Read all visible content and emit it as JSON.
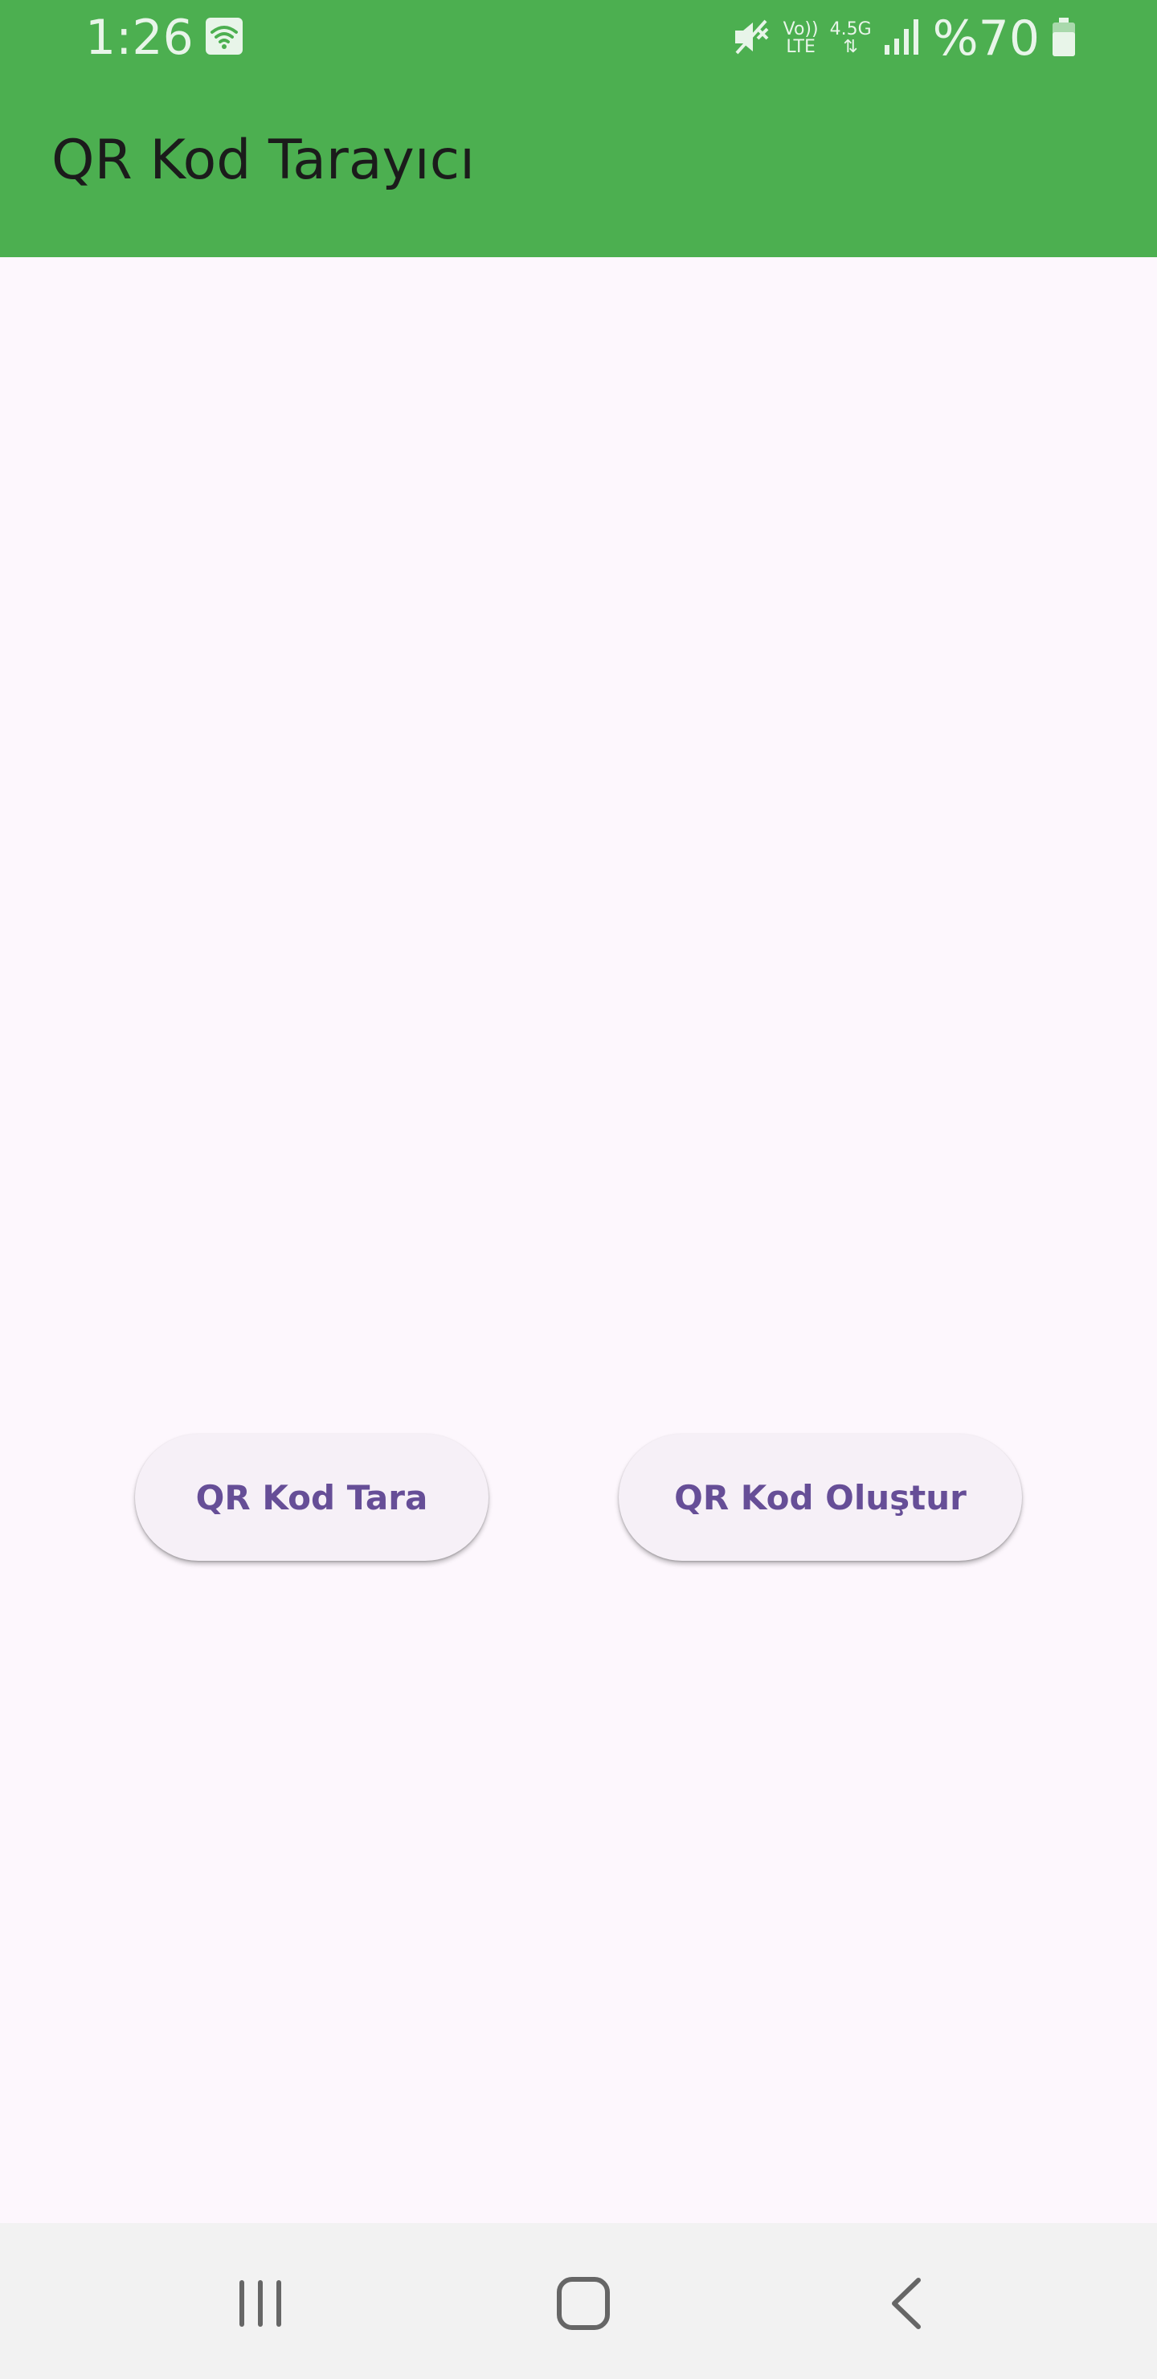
{
  "status_bar": {
    "time": "1:26",
    "network_top": "Vo))",
    "network_bottom": "LTE",
    "data_type": "4.5G",
    "battery_percent": "%70"
  },
  "app_bar": {
    "title": "QR Kod Tarayıcı",
    "color": "#4caf50"
  },
  "actions": {
    "scan_label": "QR Kod Tara",
    "create_label": "QR Kod Oluştur"
  },
  "nav_bar": {
    "recents_icon": "recents-icon",
    "home_icon": "home-icon",
    "back_icon": "back-icon"
  },
  "colors": {
    "background": "#fdf7fd",
    "button_text": "#664e97",
    "button_bg": "#f6f0f7"
  }
}
